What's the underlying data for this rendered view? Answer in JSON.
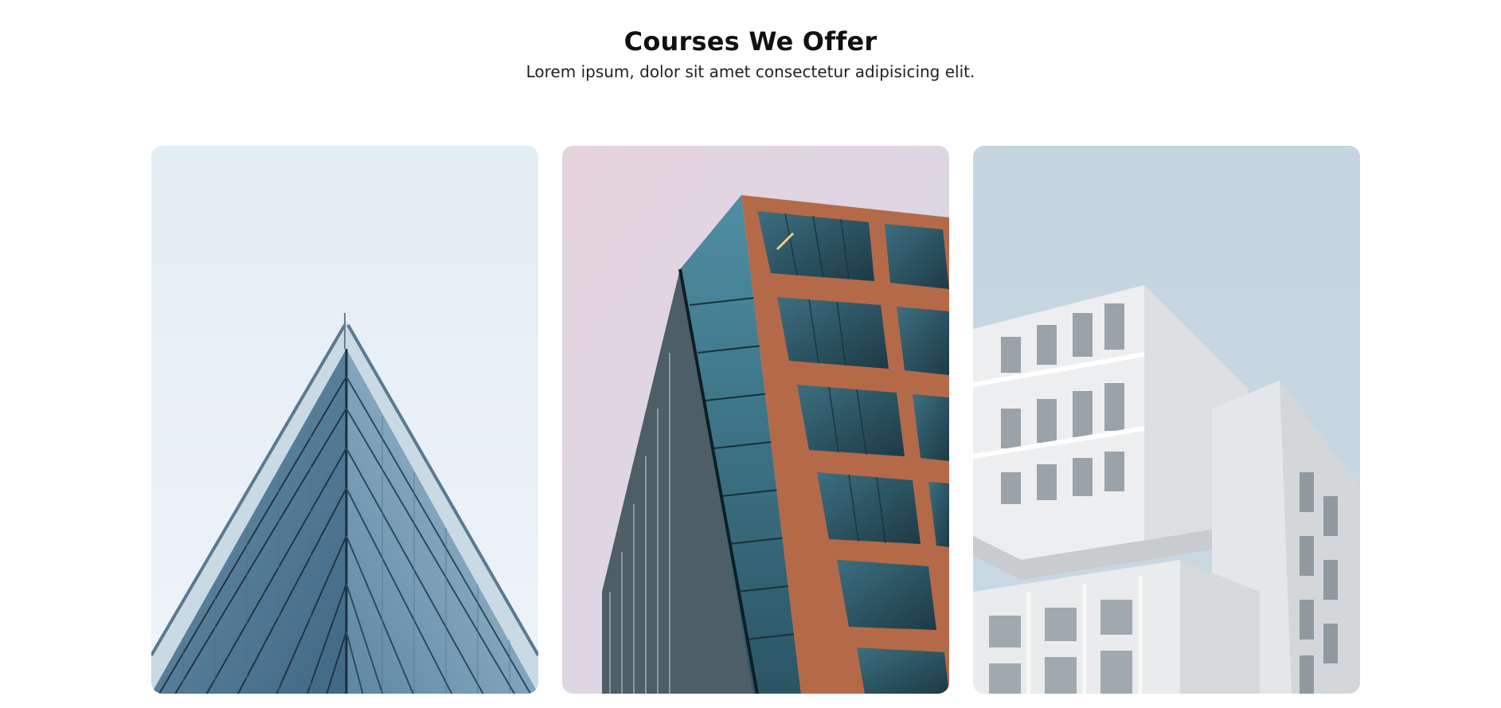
{
  "section": {
    "title": "Courses We Offer",
    "subtitle": "Lorem ipsum, dolor sit amet consectetur adipisicing elit."
  },
  "cards": [
    {
      "image": "glass-pyramid-building-photo",
      "accent": "#7fa6c2"
    },
    {
      "image": "copper-glass-tower-photo",
      "accent": "#b56a45"
    },
    {
      "image": "white-modular-building-photo",
      "accent": "#d9dde0"
    }
  ]
}
